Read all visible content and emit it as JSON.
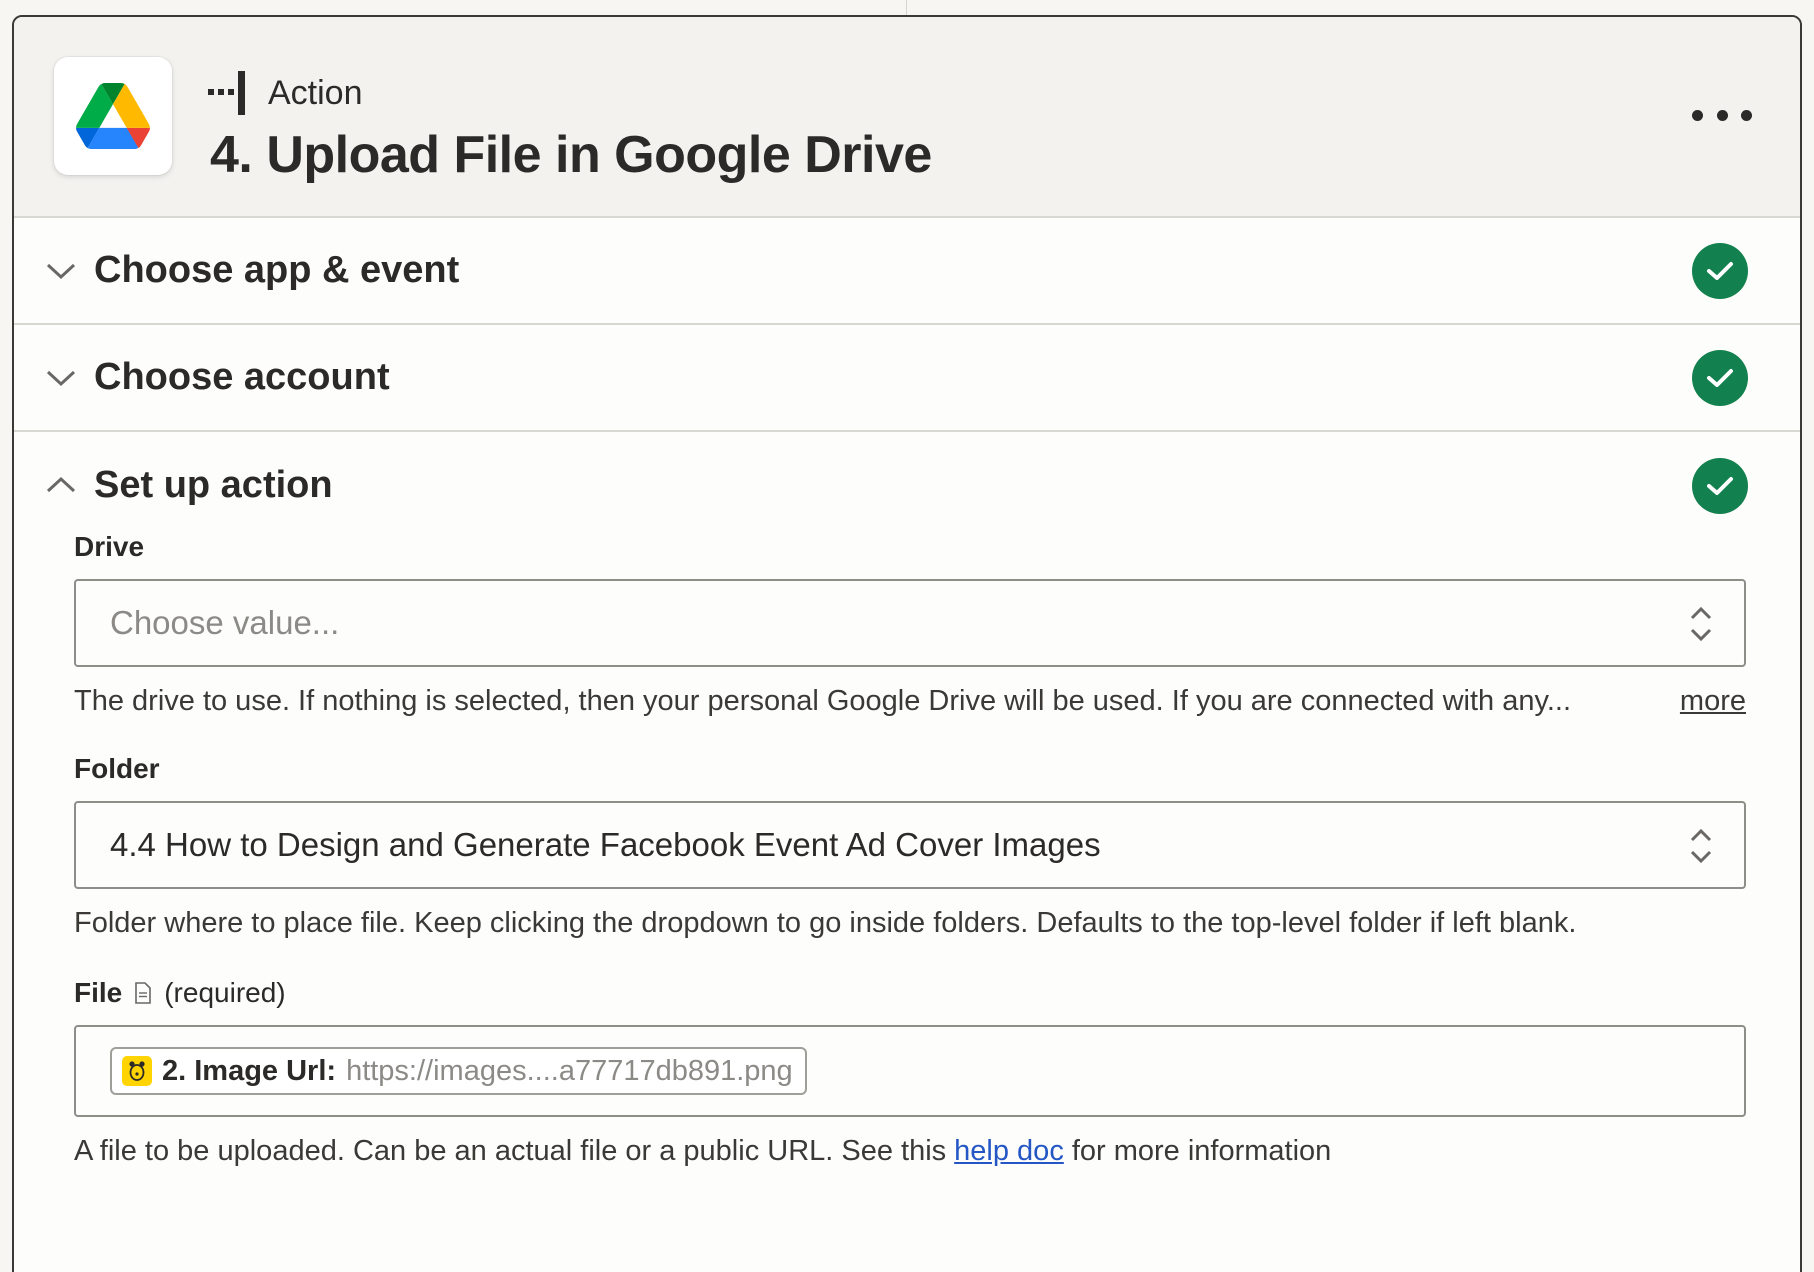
{
  "header": {
    "eyebrow": "Action",
    "title": "4. Upload File in Google Drive",
    "app_icon": "google-drive-icon",
    "step_icon": "action-step-icon",
    "menu_icon": "more-horizontal-icon"
  },
  "sections": [
    {
      "title": "Choose app & event",
      "state": "collapsed",
      "status": "complete"
    },
    {
      "title": "Choose account",
      "state": "collapsed",
      "status": "complete"
    },
    {
      "title": "Set up action",
      "state": "expanded",
      "status": "complete"
    }
  ],
  "fields": {
    "drive": {
      "label": "Drive",
      "placeholder": "Choose value...",
      "help": "The drive to use. If nothing is selected, then your personal Google Drive will be used. If you are connected with any...",
      "more_link": "more"
    },
    "folder": {
      "label": "Folder",
      "value": "4.4 How to Design and Generate Facebook Event Ad Cover Images",
      "help": "Folder where to place file. Keep clicking the dropdown to go inside folders. Defaults to the top-level folder if left blank."
    },
    "file": {
      "label": "File",
      "type_icon": "document-icon",
      "required_text": "(required)",
      "pill_label": "2. Image Url:",
      "pill_value": "https://images....a77717db891.png",
      "pill_icon": "bannerbear-icon",
      "help_before": "A file to be uploaded. Can be an actual file or a public URL. See this",
      "help_link": "help doc",
      "help_after": "for more information"
    }
  },
  "colors": {
    "check_green": "#13804f",
    "link_blue": "#2457c5",
    "pill_yellow": "#ffd400"
  }
}
